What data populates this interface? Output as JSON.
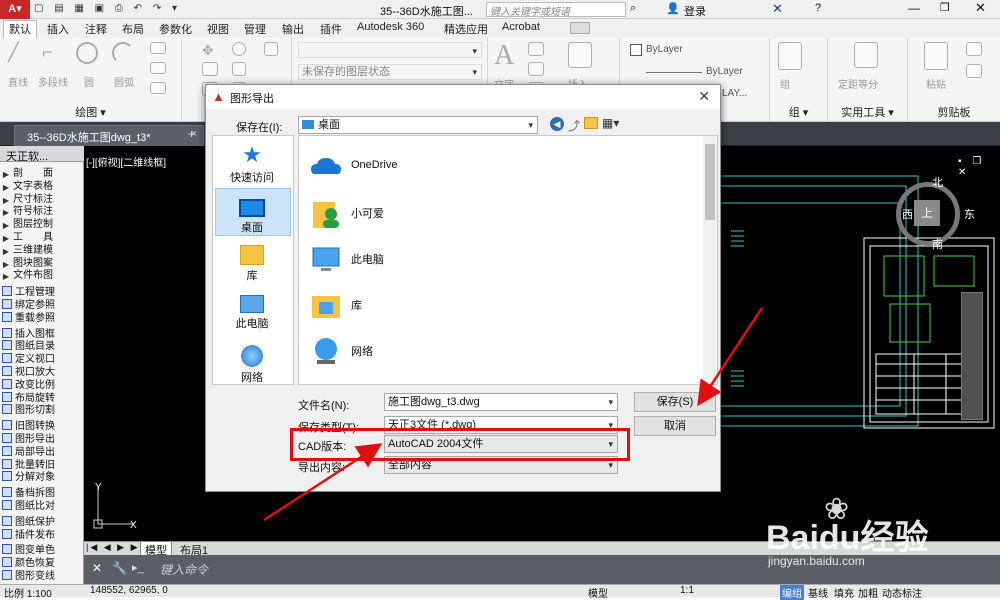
{
  "title_bar": {
    "app_title": "35--36D水施工图...",
    "search_placeholder": "键入关键字或短语",
    "login_label": "登录"
  },
  "menu_tabs": [
    "默认",
    "插入",
    "注释",
    "布局",
    "参数化",
    "视图",
    "管理",
    "输出",
    "插件",
    "Autodesk 360",
    "精选应用",
    "Acrobat"
  ],
  "ribbon": {
    "draw_labels": [
      "直线",
      "多段线",
      "圆",
      "圆弧"
    ],
    "layer_state": "未保存的图层状态",
    "text_label": "文字",
    "insert_label": "插入",
    "bylayer_1": "ByLayer",
    "bylayer_2": "ByLayer",
    "bylayer_3": "LAY...",
    "group_label": "组",
    "measure_label": "定距等分",
    "paste_label": "粘贴",
    "panel_draw": "绘图",
    "panel_group": "组",
    "panel_utilities": "实用工具",
    "panel_clipboard": "剪贴板"
  },
  "doc_tab": "35--36D水施工图dwg_t3*",
  "left_palette": {
    "header": "天正软...",
    "items": [
      {
        "label": "剖　　面",
        "group": true
      },
      {
        "label": "文字表格",
        "group": true
      },
      {
        "label": "尺寸标注",
        "group": true
      },
      {
        "label": "符号标注",
        "group": true
      },
      {
        "label": "图层控制",
        "group": true
      },
      {
        "label": "工　　具",
        "group": true
      },
      {
        "label": "三维建模",
        "group": true
      },
      {
        "label": "图块图案",
        "group": true
      },
      {
        "label": "文件布图",
        "group": true
      },
      {
        "label": "工程管理",
        "group": false
      },
      {
        "label": "绑定参照",
        "group": false
      },
      {
        "label": "重载参照",
        "group": false
      },
      {
        "label": "插入图框",
        "group": false
      },
      {
        "label": "图纸目录",
        "group": false
      },
      {
        "label": "定义视口",
        "group": false
      },
      {
        "label": "视口放大",
        "group": false
      },
      {
        "label": "改变比例",
        "group": false
      },
      {
        "label": "布局旋转",
        "group": false
      },
      {
        "label": "图形切割",
        "group": false
      },
      {
        "label": "旧图转换",
        "group": false
      },
      {
        "label": "图形导出",
        "group": false
      },
      {
        "label": "局部导出",
        "group": false
      },
      {
        "label": "批量转旧",
        "group": false
      },
      {
        "label": "分解对象",
        "group": false
      },
      {
        "label": "备档拆图",
        "group": false
      },
      {
        "label": "图纸比对",
        "group": false
      },
      {
        "label": "图纸保护",
        "group": false
      },
      {
        "label": "插件发布",
        "group": false
      },
      {
        "label": "图变单色",
        "group": false
      },
      {
        "label": "颜色恢复",
        "group": false
      },
      {
        "label": "图形变线",
        "group": false
      }
    ]
  },
  "viewport": {
    "label": "[-][俯视][二维线框]",
    "compass": {
      "north": "北",
      "south": "南",
      "east": "东",
      "west": "西",
      "center": "上"
    },
    "ucs_x": "X",
    "ucs_y": "Y"
  },
  "layout_tabs": [
    "模型",
    "布局1"
  ],
  "command_placeholder": "键入命令",
  "status": {
    "scale": "比例 1:100",
    "coords": "148552, 62965, 0",
    "model": "模型",
    "annot_scale": "1:1",
    "items": [
      "编组",
      "基线",
      "填充",
      "加粗",
      "动态标注"
    ]
  },
  "dialog": {
    "title": "图形导出",
    "save_in_label": "保存在(I):",
    "save_in_value": "桌面",
    "places": [
      "快速访问",
      "桌面",
      "库",
      "此电脑",
      "网络"
    ],
    "files": [
      "OneDrive",
      "小可爱",
      "此电脑",
      "库",
      "网络"
    ],
    "filename_label": "文件名(N):",
    "filename_value": "施工图dwg_t3.dwg",
    "filetype_label": "保存类型(T):",
    "filetype_value": "天正3文件 (*.dwg)",
    "cad_version_label": "CAD版本:",
    "cad_version_value": "AutoCAD 2004文件",
    "export_content_label": "导出内容:",
    "export_content_value": "全部内容",
    "save_button": "保存(S)",
    "cancel_button": "取消"
  },
  "watermark": {
    "brand": "Baidu经验",
    "url": "jingyan.baidu.com"
  },
  "colors": {
    "highlight": "#e01010",
    "canvas": "#000000",
    "drawing_lines": "#36c4c4",
    "selected_place": "#cce4f7"
  }
}
